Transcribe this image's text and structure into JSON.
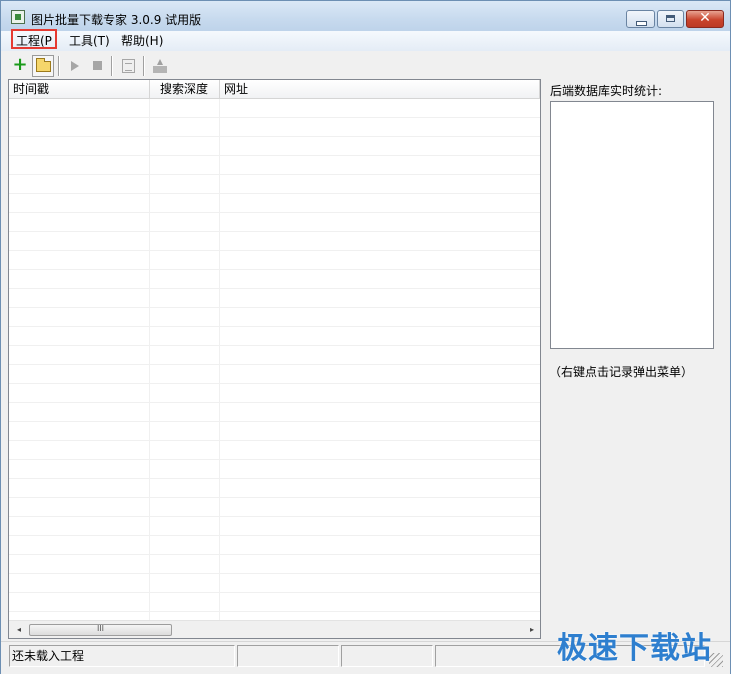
{
  "window": {
    "title": "图片批量下载专家 3.0.9 试用版",
    "close_glyph": "✕"
  },
  "menu": {
    "project": "工程(P",
    "tools": "工具(T)",
    "help": "帮助(H)"
  },
  "toolbar": {
    "new_glyph": "+"
  },
  "table": {
    "columns": [
      "时间戳",
      "搜索深度",
      "网址"
    ],
    "rows": []
  },
  "scrollbar": {
    "left_arrow": "◂",
    "right_arrow": "▸",
    "thumb_grip": "III"
  },
  "stats": {
    "label": "后端数据库实时统计:",
    "hint": "（右键点击记录弹出菜单）"
  },
  "status": {
    "text": "还未载入工程"
  },
  "watermark": {
    "text": "极速下载站"
  },
  "colors": {
    "titlebar": "#c7daee",
    "close_button": "#c9442d",
    "menu_highlight_border": "#e53a32",
    "watermark": "#2e7fcf"
  }
}
